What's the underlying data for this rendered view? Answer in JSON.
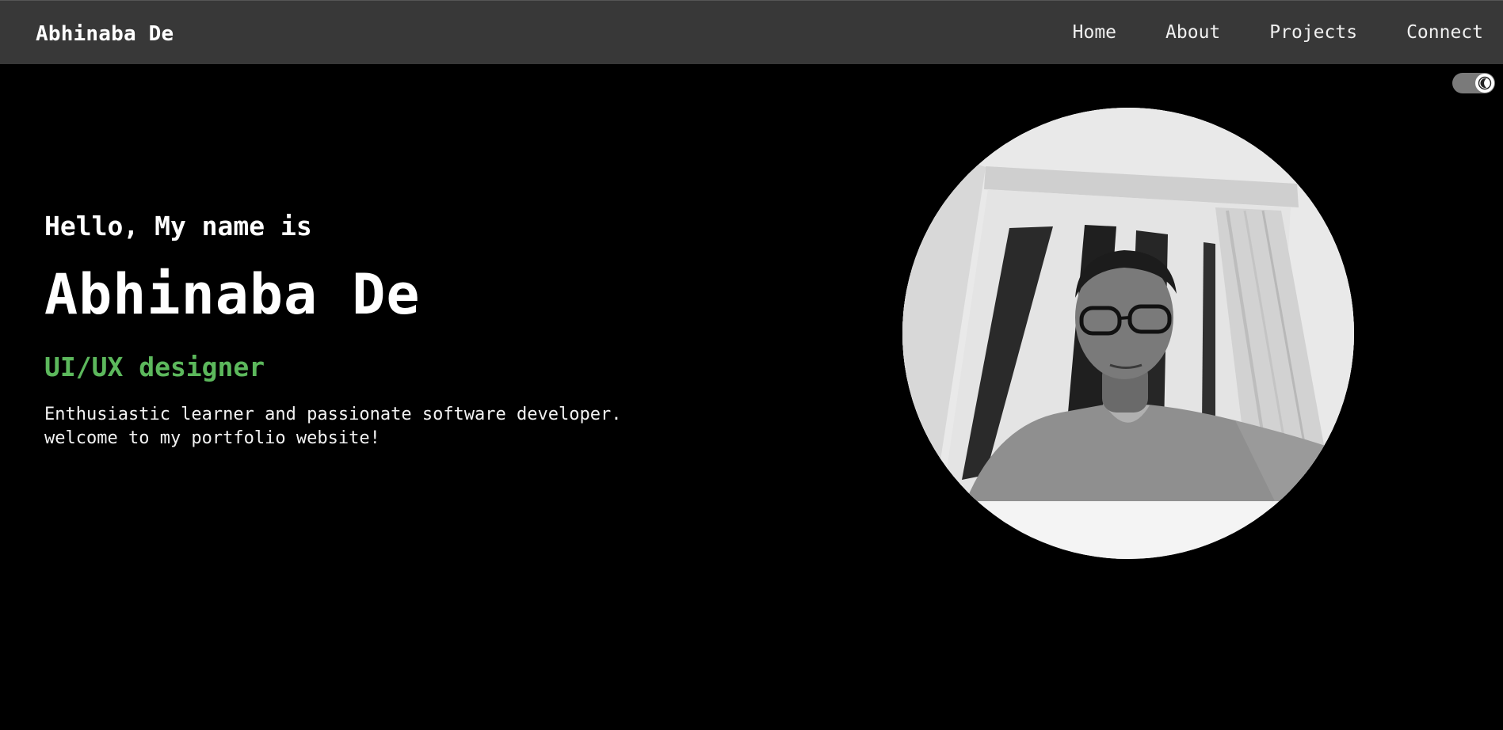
{
  "header": {
    "brand": "Abhinaba De",
    "nav": [
      {
        "label": "Home"
      },
      {
        "label": "About"
      },
      {
        "label": "Projects"
      },
      {
        "label": "Connect"
      }
    ]
  },
  "theme_toggle": {
    "icon": "moon-icon",
    "state": "dark"
  },
  "hero": {
    "greeting": "Hello, My name is",
    "name": "Abhinaba De",
    "role": "UI/UX designer",
    "intro_line1": "Enthusiastic learner and passionate software developer.",
    "intro_line2": "welcome to my portfolio website!"
  },
  "profile_photo": {
    "subject": "grayscale portrait of a young man with glasses in front of a window"
  },
  "colors": {
    "background": "#000000",
    "navbar": "#383838",
    "accent_green": "#5cb85c",
    "text": "#ffffff"
  }
}
